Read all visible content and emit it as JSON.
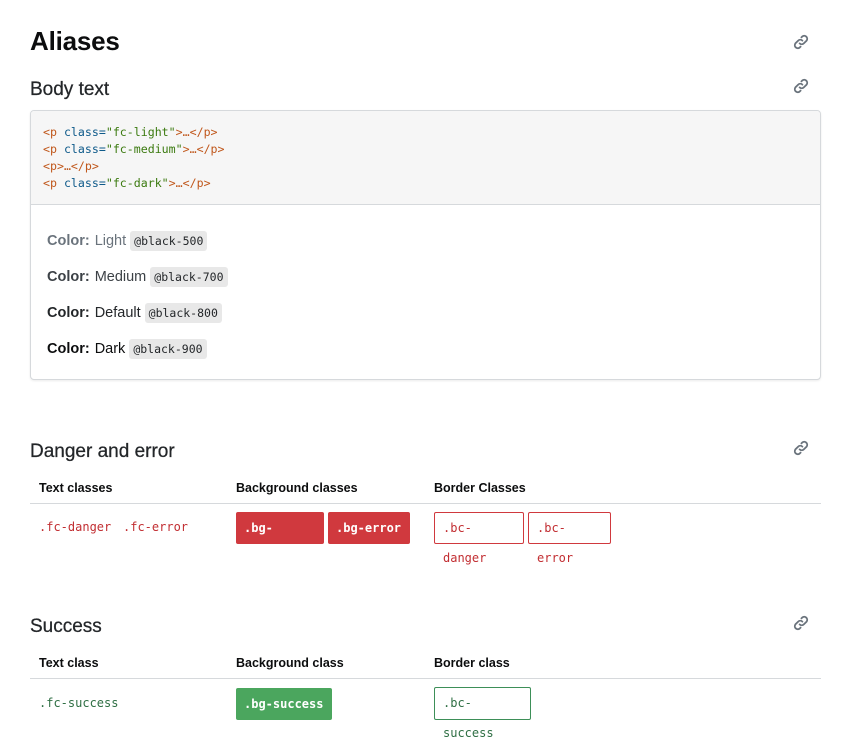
{
  "title": "Aliases",
  "body_text": {
    "heading": "Body text",
    "code_lines": [
      {
        "open": "<p",
        "attr": " class=",
        "str": "\"fc-light\"",
        "rest": ">…</p>"
      },
      {
        "open": "<p",
        "attr": " class=",
        "str": "\"fc-medium\"",
        "rest": ">…</p>"
      },
      {
        "open": "<p>",
        "attr": "",
        "str": "",
        "rest": "…</p>"
      },
      {
        "open": "<p",
        "attr": " class=",
        "str": "\"fc-dark\"",
        "rest": ">…</p>"
      }
    ],
    "examples": [
      {
        "label": "Color:",
        "name": "Light",
        "chip": "@black-500"
      },
      {
        "label": "Color:",
        "name": "Medium",
        "chip": "@black-700"
      },
      {
        "label": "Color:",
        "name": "Default",
        "chip": "@black-800"
      },
      {
        "label": "Color:",
        "name": "Dark",
        "chip": "@black-900"
      }
    ]
  },
  "danger": {
    "heading": "Danger and error",
    "headers": [
      "Text classes",
      "Background classes",
      "Border Classes"
    ],
    "text_classes": [
      ".fc-danger",
      ".fc-error"
    ],
    "bg_classes": [
      ".bg-danger",
      ".bg-error"
    ],
    "border_classes": [
      ".bc-danger",
      ".bc-error"
    ]
  },
  "success": {
    "heading": "Success",
    "headers": [
      "Text class",
      "Background class",
      "Border class"
    ],
    "text_class": ".fc-success",
    "bg_class": ".bg-success",
    "border_class": ".bc-success"
  },
  "icons": {
    "link": "link-icon"
  },
  "colors": {
    "danger": "#d0393e",
    "success": "#4ba65e",
    "code_bg": "#f6f6f6"
  }
}
